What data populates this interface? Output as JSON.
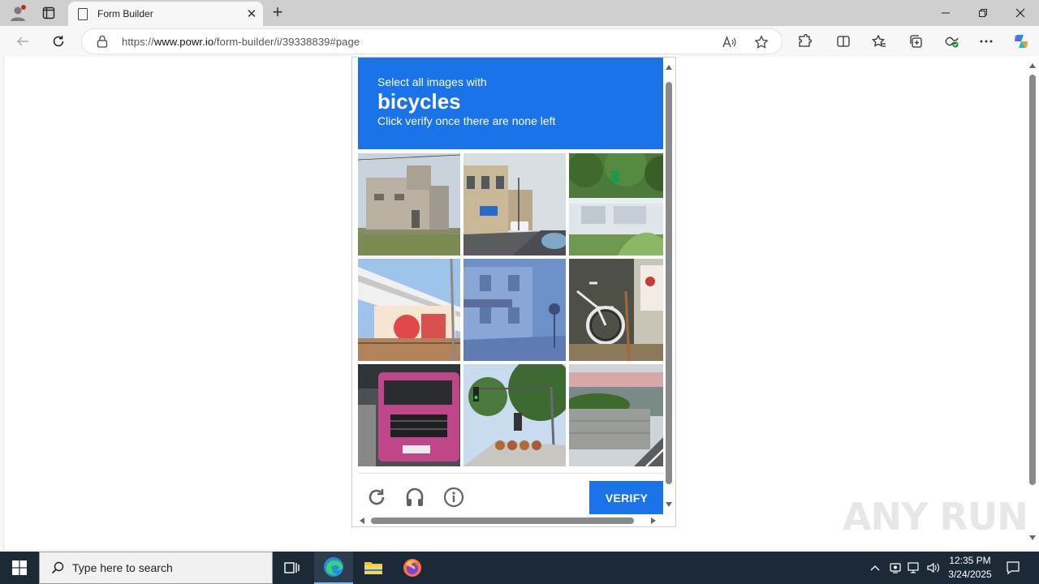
{
  "browser": {
    "tab_title": "Form Builder",
    "url_prefix": "https://",
    "url_host": "www.powr.io",
    "url_path": "/form-builder/i/39338839#page"
  },
  "captcha": {
    "instruction": "Select all images with",
    "target": "bicycles",
    "hint": "Click verify once there are none left",
    "verify_label": "VERIFY",
    "tiles": [
      {
        "scene": "industrial building"
      },
      {
        "scene": "street with shops"
      },
      {
        "scene": "bridge with trees"
      },
      {
        "scene": "building with billboard"
      },
      {
        "scene": "street building"
      },
      {
        "scene": "parked bicycle"
      },
      {
        "scene": "pink truck"
      },
      {
        "scene": "traffic light street"
      },
      {
        "scene": "bus stop shelter"
      }
    ],
    "header_color": "#1a73e8"
  },
  "watermark": "ANY RUN",
  "taskbar": {
    "search_placeholder": "Type here to search",
    "time": "12:35 PM",
    "date": "3/24/2025"
  }
}
